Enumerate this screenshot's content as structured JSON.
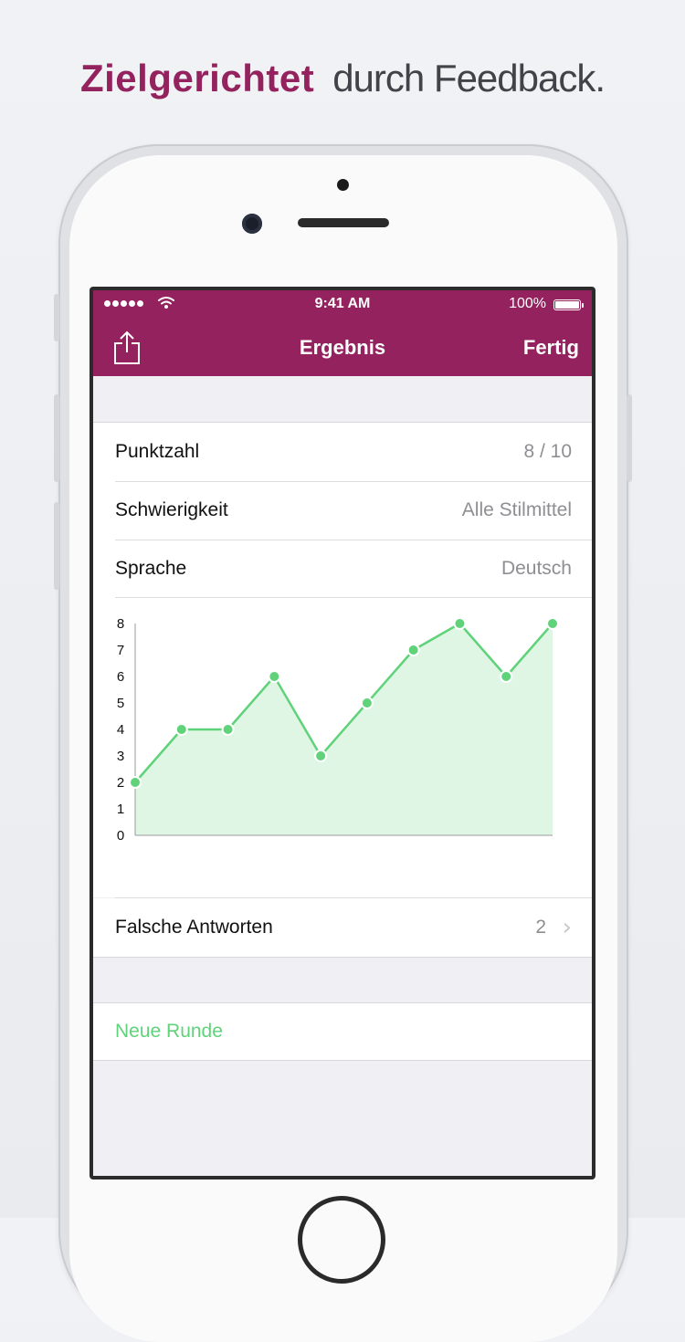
{
  "headline": {
    "bold": "Zielgerichtet",
    "light": "durch Feedback."
  },
  "status_bar": {
    "time": "9:41 AM",
    "battery": "100%"
  },
  "nav": {
    "title": "Ergebnis",
    "done": "Fertig",
    "share_icon": "share-icon"
  },
  "info_rows": [
    {
      "label": "Punktzahl",
      "value": "8 / 10"
    },
    {
      "label": "Schwierigkeit",
      "value": "Alle Stilmittel"
    },
    {
      "label": "Sprache",
      "value": "Deutsch"
    }
  ],
  "chart_data": {
    "type": "area",
    "x": [
      1,
      2,
      3,
      4,
      5,
      6,
      7,
      8,
      9,
      10
    ],
    "values": [
      2,
      4,
      4,
      6,
      3,
      5,
      7,
      8,
      6,
      8
    ],
    "yticks": [
      "0",
      "1",
      "2",
      "3",
      "4",
      "5",
      "6",
      "7",
      "8"
    ],
    "ylim": [
      0,
      8
    ],
    "grid": false,
    "line_color": "#5fd27a",
    "fill_color": "#dff6e5"
  },
  "wrong_answers": {
    "label": "Falsche Antworten",
    "value": "2"
  },
  "new_round": {
    "label": "Neue Runde"
  },
  "colors": {
    "accent": "#93225e",
    "green": "#5fd27a"
  }
}
